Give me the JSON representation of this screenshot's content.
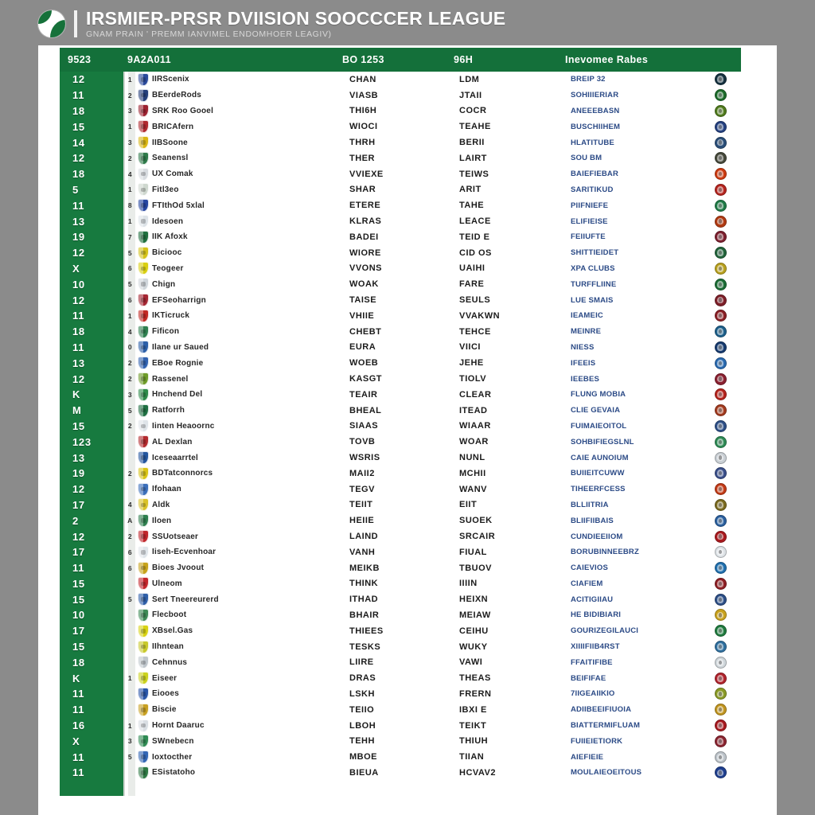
{
  "brand": {
    "title": "IRSMIER-PRSR DVIISION SOOCCCER LEAGUE",
    "subtitle": "GNAM PRAIN ' PREMM IANVIMEL ENDOMHOER LEAGIV)",
    "logo_icon": "soccer-ball-logo-icon"
  },
  "table": {
    "columns": [
      {
        "key": "rank",
        "label": "9523"
      },
      {
        "key": "team",
        "label": "9A2A011"
      },
      {
        "key": "c3",
        "label": "BO 1253"
      },
      {
        "key": "c4",
        "label": "96H"
      },
      {
        "key": "c5",
        "label": "Inevomee Rabes"
      },
      {
        "key": "badge",
        "label": ""
      }
    ],
    "header_color": "#14703a",
    "rank_column_color": "#177a3f",
    "link_text_color": "#2b4a86",
    "rows": [
      {
        "rank": "12",
        "pos": "1",
        "team": "IIRScenix",
        "crest": "#2b4a9b",
        "c3": "CHAN",
        "c4": "LDM",
        "c5": "BREIP 32",
        "badge": "#15313f"
      },
      {
        "rank": "11",
        "pos": "2",
        "team": "BEerdeRods",
        "crest": "#253f7a",
        "c3": "VIASB",
        "c4": "JTAII",
        "c5": "SOHIIIERIAR",
        "badge": "#1c6b2a"
      },
      {
        "rank": "18",
        "pos": "3",
        "team": "SRK Roo Gooel",
        "crest": "#9c2230",
        "c3": "THI6H",
        "c4": "COCR",
        "c5": "ANEEEBASN",
        "badge": "#4f7a1c"
      },
      {
        "rank": "15",
        "pos": "1",
        "team": "BRICAfern",
        "crest": "#b02a30",
        "c3": "WIOCI",
        "c4": "TEAHE",
        "c5": "BUSCHIIHEM",
        "badge": "#24407f"
      },
      {
        "rank": "14",
        "pos": "3",
        "team": "IIBSoone",
        "crest": "#d9b614",
        "c3": "THRH",
        "c4": "BERII",
        "c5": "HLATITUBE",
        "badge": "#2a4e78"
      },
      {
        "rank": "12",
        "pos": "2",
        "team": "Seanensl",
        "crest": "#2f7a4a",
        "c3": "THER",
        "c4": "LAIRT",
        "c5": "SOU BM",
        "badge": "#45483a"
      },
      {
        "rank": "18",
        "pos": "4",
        "team": "UX Comak",
        "crest": "#d8dce0",
        "c3": "VVIEXE",
        "c4": "TEIWS",
        "c5": "BAIEFIEBAR",
        "badge": "#cc3a10"
      },
      {
        "rank": "5",
        "pos": "1",
        "team": "Fitl3eo",
        "crest": "#cfd8cf",
        "c3": "SHAR",
        "c4": "ARIT",
        "c5": "SARITIKUD",
        "badge": "#b4241e"
      },
      {
        "rank": "11",
        "pos": "8",
        "team": "FTIthOd 5xlal",
        "crest": "#2646a0",
        "c3": "ETERE",
        "c4": "TAHE",
        "c5": "PIIFNIEFE",
        "badge": "#1f7a46"
      },
      {
        "rank": "13",
        "pos": "1",
        "team": "Idesoen",
        "crest": "#dde3e8",
        "c3": "KLRAS",
        "c4": "LEACE",
        "c5": "ELIFIEISE",
        "badge": "#b03a12"
      },
      {
        "rank": "19",
        "pos": "7",
        "team": "IIK Afoxk",
        "crest": "#1f6f3e",
        "c3": "BADEI",
        "c4": "TEID E",
        "c5": "FEIIUFTE",
        "badge": "#7c1f2e"
      },
      {
        "rank": "12",
        "pos": "5",
        "team": "Biciooc",
        "crest": "#d4c21a",
        "c3": "WIORE",
        "c4": "CID OS",
        "c5": "SHITTIEIDET",
        "badge": "#21633a"
      },
      {
        "rank": "X",
        "pos": "6",
        "team": "Teogeer",
        "crest": "#d9cf12",
        "c3": "VVONS",
        "c4": "UAIHI",
        "c5": "XPA CLUBS",
        "badge": "#b8a01e"
      },
      {
        "rank": "10",
        "pos": "5",
        "team": "Chign",
        "crest": "#d0d6db",
        "c3": "WOAK",
        "c4": "FARE",
        "c5": "TURFFLIINE",
        "badge": "#1b6c35"
      },
      {
        "rank": "12",
        "pos": "6",
        "team": "EFSeoharrign",
        "crest": "#a52733",
        "c3": "TAISE",
        "c4": "SEULS",
        "c5": "LUE SMAIS",
        "badge": "#7d1f28"
      },
      {
        "rank": "11",
        "pos": "1",
        "team": "IKTicruck",
        "crest": "#c22a24",
        "c3": "VHIIE",
        "c4": "VVAKWN",
        "c5": "IEAMEIC",
        "badge": "#8a1f25"
      },
      {
        "rank": "18",
        "pos": "4",
        "team": "Fificon",
        "crest": "#2f8050",
        "c3": "CHEBT",
        "c4": "TEHCE",
        "c5": "MEINRE",
        "badge": "#1d5f8a"
      },
      {
        "rank": "11",
        "pos": "0",
        "team": "Ilane ur Saued",
        "crest": "#2c5fa8",
        "c3": "EURA",
        "c4": "VIICI",
        "c5": "NIESS",
        "badge": "#163a6e"
      },
      {
        "rank": "13",
        "pos": "2",
        "team": "EBoe Rognie",
        "crest": "#3263b0",
        "c3": "WOEB",
        "c4": "JEHE",
        "c5": "IFEEIS",
        "badge": "#2a6ab0"
      },
      {
        "rank": "12",
        "pos": "2",
        "team": "Rassenel",
        "crest": "#6f9c2a",
        "c3": "KASGT",
        "c4": "TIOLV",
        "c5": "IEEBES",
        "badge": "#8a2030"
      },
      {
        "rank": "K",
        "pos": "3",
        "team": "Hnchend Del",
        "crest": "#2e8a4a",
        "c3": "TEAIR",
        "c4": "CLEAR",
        "c5": "FLUNG MOBIA",
        "badge": "#b5231c"
      },
      {
        "rank": "M",
        "pos": "5",
        "team": "Ratforrh",
        "crest": "#1f6f42",
        "c3": "BHEAL",
        "c4": "ITEAD",
        "c5": "CLIE GEVAIA",
        "badge": "#a23a1e"
      },
      {
        "rank": "15",
        "pos": "2",
        "team": "Iinten Heaoornc",
        "crest": "#dfe4e9",
        "c3": "SIAAS",
        "c4": "WIAAR",
        "c5": "FUIMAIEOITOL",
        "badge": "#2d4f86"
      },
      {
        "rank": "123",
        "pos": "",
        "team": "AL Dexlan",
        "crest": "#b22a2e",
        "c3": "TOVB",
        "c4": "WOAR",
        "c5": "SOHBIFIEGSLNL",
        "badge": "#2e8a55"
      },
      {
        "rank": "13",
        "pos": "",
        "team": "Iceseaarrtel",
        "crest": "#24569e",
        "c3": "WSRIS",
        "c4": "NUNL",
        "c5": "CAIE AUNOIUM",
        "badge": "#c9cfd4"
      },
      {
        "rank": "19",
        "pos": "2",
        "team": "BDTatconnorcs",
        "crest": "#d9c416",
        "c3": "MAII2",
        "c4": "MCHII",
        "c5": "BUIIEITCUWW",
        "badge": "#3a4f8a"
      },
      {
        "rank": "12",
        "pos": "",
        "team": "Ifohaan",
        "crest": "#3b6fba",
        "c3": "TEGV",
        "c4": "WANV",
        "c5": "TIHEERFCESS",
        "badge": "#c23a16"
      },
      {
        "rank": "17",
        "pos": "4",
        "team": "Aldk",
        "crest": "#d9c22a",
        "c3": "TEIIT",
        "c4": "EIIT",
        "c5": "BLLIITRIA",
        "badge": "#7a6a1f"
      },
      {
        "rank": "2",
        "pos": "A",
        "team": "Iloen",
        "crest": "#2f7f4f",
        "c3": "HEIIE",
        "c4": "SUOEK",
        "c5": "BLIIFIIBAIS",
        "badge": "#2a5f9e"
      },
      {
        "rank": "12",
        "pos": "2",
        "team": "SSUotseaer",
        "crest": "#c0262c",
        "c3": "LAIND",
        "c4": "SRCAIR",
        "c5": "CUNDIEEIIOM",
        "badge": "#a9191e"
      },
      {
        "rank": "17",
        "pos": "6",
        "team": "Iiseh-Ecvenhoar",
        "crest": "#dfe5ea",
        "c3": "VANH",
        "c4": "FIUAL",
        "c5": "BORUBINNEEBRZ",
        "badge": "#dde2e6"
      },
      {
        "rank": "11",
        "pos": "6",
        "team": "Bioes Jvoout",
        "crest": "#c7a31c",
        "c3": "MEIKB",
        "c4": "TBUOV",
        "c5": "CAIEVIOS",
        "badge": "#1f6fae"
      },
      {
        "rank": "15",
        "pos": "",
        "team": "Ulneom",
        "crest": "#c3262c",
        "c3": "THINK",
        "c4": "IIIIN",
        "c5": "CIAFIEM",
        "badge": "#8e1f24"
      },
      {
        "rank": "15",
        "pos": "5",
        "team": "Sert Tneereurerd",
        "crest": "#2f5fa8",
        "c3": "ITHAD",
        "c4": "HEIXN",
        "c5": "ACITIGIIAU",
        "badge": "#2c4e86"
      },
      {
        "rank": "10",
        "pos": "",
        "team": "Flecboot",
        "crest": "#3f8a56",
        "c3": "BHAIR",
        "c4": "MEIAW",
        "c5": "HE BIDIBIARI",
        "badge": "#c9a21e"
      },
      {
        "rank": "17",
        "pos": "",
        "team": "XBsel.Gas",
        "crest": "#d8d213",
        "c3": "THIEES",
        "c4": "CEIHU",
        "c5": "GOURIZEGILAUCI",
        "badge": "#1f7a3e"
      },
      {
        "rank": "15",
        "pos": "",
        "team": "IIhntean",
        "crest": "#c8c92c",
        "c3": "TESKS",
        "c4": "WUKY",
        "c5": "XIIIIFIIB4RST",
        "badge": "#2f6f9e"
      },
      {
        "rank": "18",
        "pos": "",
        "team": "Cehnnus",
        "crest": "#bfc6cc",
        "c3": "LIIRE",
        "c4": "VAWI",
        "c5": "FFAITIFIBE",
        "badge": "#cfd6da"
      },
      {
        "rank": "K",
        "pos": "1",
        "team": "Eiseer",
        "crest": "#cbd21f",
        "c3": "DRAS",
        "c4": "THEAS",
        "c5": "BEIFIFAE",
        "badge": "#b0232c"
      },
      {
        "rank": "11",
        "pos": "",
        "team": "Eiooes",
        "crest": "#2a56a8",
        "c3": "LSKH",
        "c4": "FRERN",
        "c5": "7IIGEAIIKIO",
        "badge": "#8a9a26"
      },
      {
        "rank": "11",
        "pos": "",
        "team": "Biscie",
        "crest": "#c8a022",
        "c3": "TEIIO",
        "c4": "IBXI E",
        "c5": "ADIIBEEIFIUOIA",
        "badge": "#c0941f"
      },
      {
        "rank": "16",
        "pos": "1",
        "team": "Hornt Daaruc",
        "crest": "#d9dee3",
        "c3": "LBOH",
        "c4": "TEIKT",
        "c5": "BIATTERMIFLUAM",
        "badge": "#a7191f"
      },
      {
        "rank": "X",
        "pos": "3",
        "team": "SWnebecn",
        "crest": "#2f8a53",
        "c3": "TEHH",
        "c4": "THIUH",
        "c5": "FUIIEIETIORK",
        "badge": "#8a2430"
      },
      {
        "rank": "11",
        "pos": "5",
        "team": "Ioxtocther",
        "crest": "#3366b5",
        "c3": "MBOE",
        "c4": "TIIAN",
        "c5": "AIEFIEIE",
        "badge": "#bcc3c9"
      },
      {
        "rank": "11",
        "pos": "",
        "team": "ESistatoho",
        "crest": "#2f7a45",
        "c3": "BIEUA",
        "c4": "HCVAV2",
        "c5": "MOULAIEOEITOUS",
        "badge": "#1f3f8e"
      }
    ]
  }
}
